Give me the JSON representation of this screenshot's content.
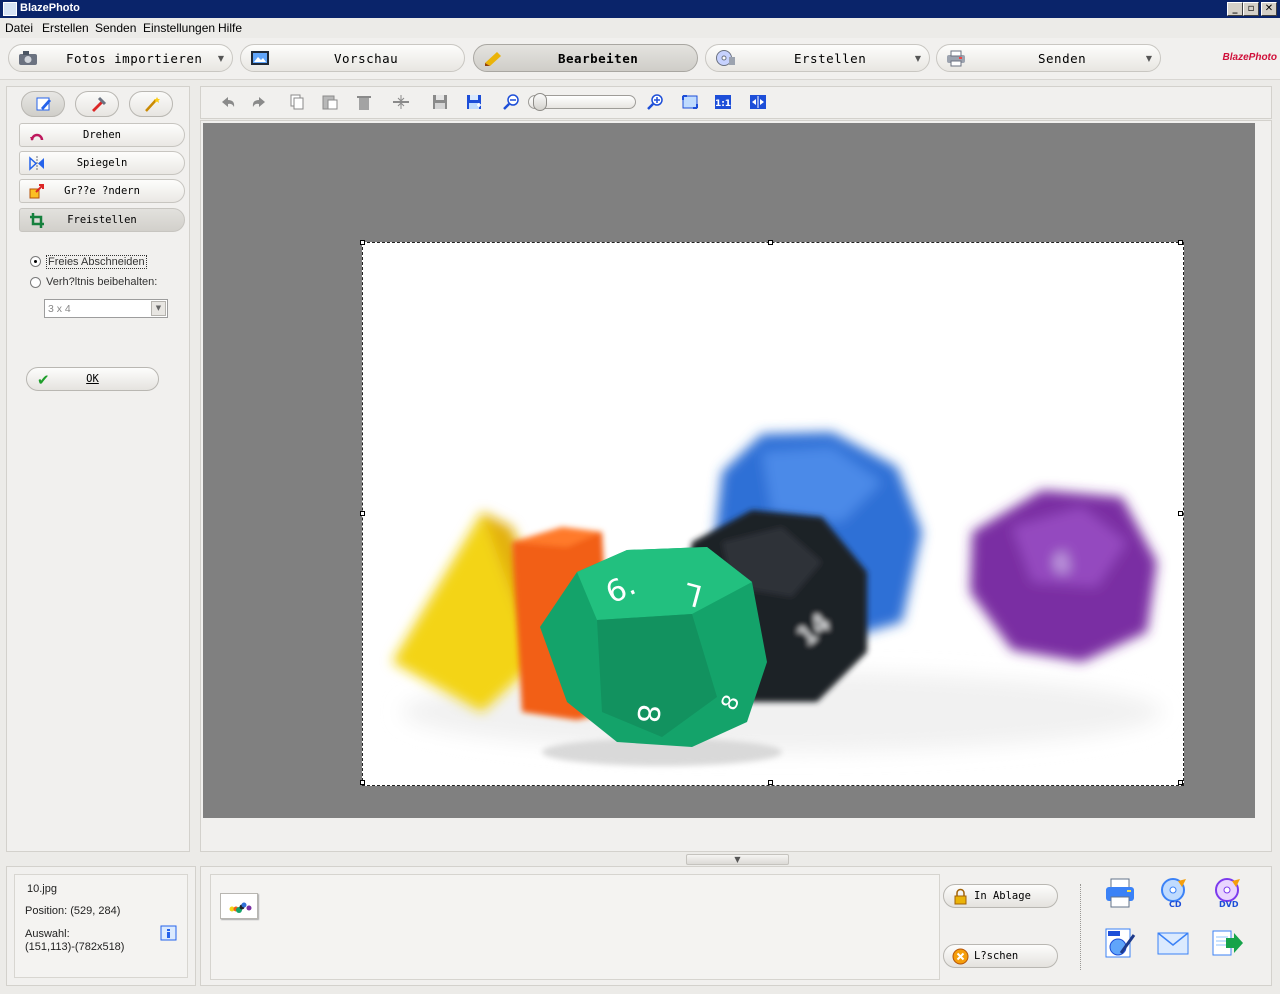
{
  "app": {
    "title": "BlazePhoto",
    "brand": "BlazePhoto"
  },
  "window_controls": {
    "minimize": "_",
    "restore": "▫",
    "close": "✕"
  },
  "menu": [
    "Datei",
    "Erstellen",
    "Senden",
    "Einstellungen",
    "Hilfe"
  ],
  "nav": {
    "import": "Fotos importieren",
    "preview": "Vorschau",
    "edit": "Bearbeiten",
    "create": "Erstellen",
    "send": "Senden",
    "active": "Bearbeiten"
  },
  "edit_tools": {
    "rotate": "Drehen",
    "mirror": "Spiegeln",
    "resize": "Gr??e ?ndern",
    "crop": "Freistellen",
    "active": "Freistellen"
  },
  "crop_options": {
    "free_crop": "Freies Abschneiden",
    "keep_ratio": "Verh?ltnis beibehalten:",
    "selected_mode": "Freies Abschneiden",
    "ratio_value": "3 x 4",
    "ok": "OK"
  },
  "zoom": {
    "level": 0.05
  },
  "info": {
    "filename": "10.jpg",
    "position": "Position: (529, 284)",
    "selection_label": "Auswahl:",
    "selection_value": "(151,113)-(782x518)"
  },
  "tray": {
    "add_to_tray": "In Ablage",
    "delete": "L?schen"
  },
  "actions": [
    "print-icon",
    "burn-cd-icon",
    "burn-dvd-icon",
    "html-export-icon",
    "email-icon",
    "export-icon"
  ],
  "colors": {
    "titlebar": "#0a246a",
    "canvas_bg": "#808080",
    "accent_green": "#1e9e2a",
    "brand_red": "#d0103a"
  }
}
